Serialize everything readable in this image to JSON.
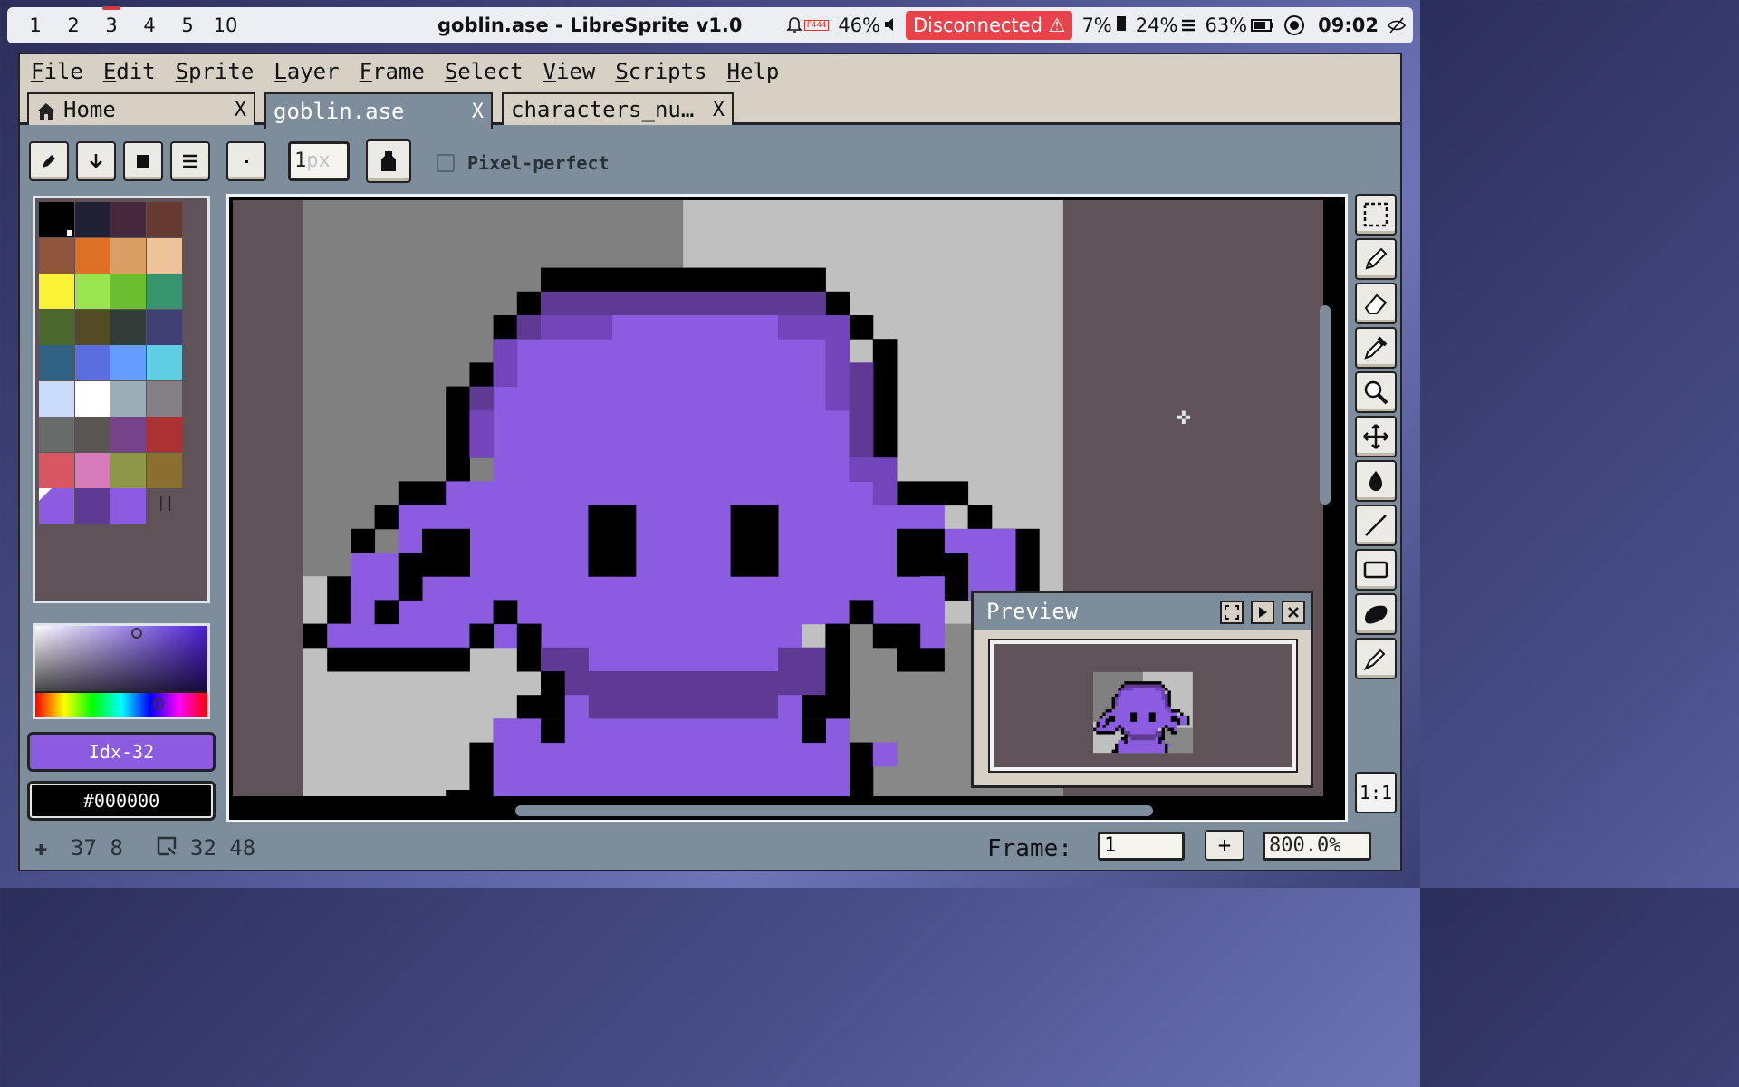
{
  "system_bar": {
    "workspaces": [
      "1",
      "2",
      "3",
      "4",
      "5",
      "10"
    ],
    "active_workspace": "3",
    "window_title": "goblin.ase - LibreSprite v1.0",
    "notification_badge": "F444",
    "volume": "46%",
    "network_status": "Disconnected",
    "cpu": "7%",
    "memory": "24%",
    "battery": "63%",
    "clock": "09:02"
  },
  "menubar": {
    "items": [
      "File",
      "Edit",
      "Sprite",
      "Layer",
      "Frame",
      "Select",
      "View",
      "Scripts",
      "Help"
    ]
  },
  "tabs": [
    {
      "label": "Home",
      "close": "X"
    },
    {
      "label": "goblin.ase",
      "close": "X"
    },
    {
      "label": "characters_nu…",
      "close": "X"
    }
  ],
  "toolbar": {
    "brush_size": "1px",
    "pixel_perfect_label": "Pixel-perfect",
    "pixel_perfect_checked": false
  },
  "palette": {
    "colors": [
      "#000000",
      "#222034",
      "#45283c",
      "#663931",
      "#8f563b",
      "#df7126",
      "#d9a066",
      "#eec39a",
      "#fbf236",
      "#99e550",
      "#6abe30",
      "#37946e",
      "#4b692f",
      "#524b24",
      "#323c39",
      "#3f3f74",
      "#306082",
      "#5b6ee1",
      "#639bff",
      "#5fcde4",
      "#cbdbfc",
      "#ffffff",
      "#9badb7",
      "#847e87",
      "#696a6a",
      "#595652",
      "#76428a",
      "#ac3232",
      "#d95763",
      "#d77bba",
      "#8f974a",
      "#8a6f30",
      "#8b5be0",
      "#5e3a94",
      "#8b5be0"
    ]
  },
  "colors": {
    "foreground_label": "Idx-32",
    "foreground": "#8b5be0",
    "background_label": "#000000",
    "background": "#000000"
  },
  "preview": {
    "title": "Preview"
  },
  "status": {
    "cursor_pos": "37 8",
    "sprite_size": "32 48",
    "frame_label": "Frame:",
    "frame_value": "1",
    "add_frame": "+",
    "zoom": "800.0%",
    "zoom_reset": "1:1"
  }
}
